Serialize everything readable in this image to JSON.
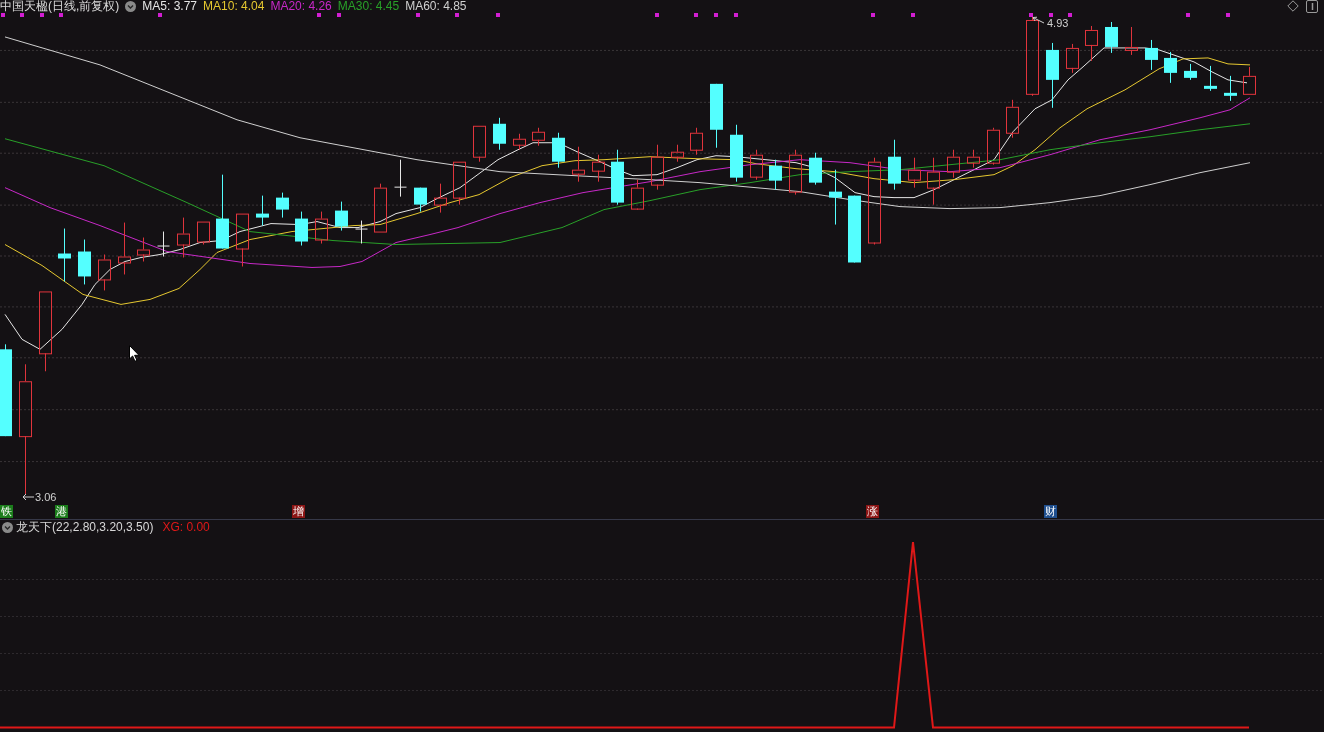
{
  "chart_title": "中国天楹(日线,前复权)",
  "moving_averages": [
    {
      "label": "MA5: 3.77",
      "color": "#e6e6e6"
    },
    {
      "label": "MA10: 4.04",
      "color": "#e6c830"
    },
    {
      "label": "MA20: 4.26",
      "color": "#c828c8"
    },
    {
      "label": "MA30: 4.45",
      "color": "#28a028"
    },
    {
      "label": "MA60: 4.85",
      "color": "#d0d0d0"
    }
  ],
  "price_marks": [
    {
      "label": "4.93",
      "kind": "high"
    },
    {
      "label": "3.06",
      "kind": "low"
    }
  ],
  "event_tags": [
    {
      "label": "铁",
      "color": "#1b7d1b"
    },
    {
      "label": "港",
      "color": "#1b7d1b"
    },
    {
      "label": "增",
      "color": "#8b1515"
    },
    {
      "label": "涨",
      "color": "#8b1515"
    },
    {
      "label": "财",
      "color": "#1f4f8f"
    }
  ],
  "indicator": {
    "name": "龙天下(22,2.80,3.20,3.50)",
    "value": "XG: 0.00",
    "color": "#e01818"
  }
}
